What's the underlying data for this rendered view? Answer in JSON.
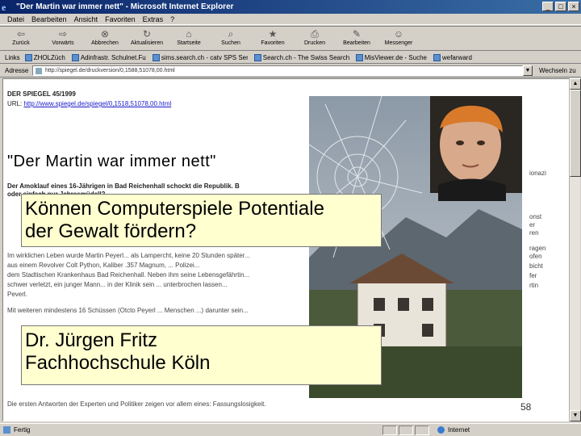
{
  "window": {
    "title": "\"Der Martin war immer nett\" - Microsoft Internet Explorer",
    "buttons": {
      "minimize": "_",
      "maximize": "□",
      "close": "×"
    }
  },
  "menu": [
    "Datei",
    "Bearbeiten",
    "Ansicht",
    "Favoriten",
    "Extras",
    "?"
  ],
  "toolbar": [
    {
      "label": "Zurück",
      "icon": "back-arrow-icon",
      "glyph": "⇦"
    },
    {
      "label": "Vorwärts",
      "icon": "forward-arrow-icon",
      "glyph": "⇨"
    },
    {
      "label": "Abbrechen",
      "icon": "stop-icon",
      "glyph": "⊗"
    },
    {
      "label": "Aktualisieren",
      "icon": "refresh-icon",
      "glyph": "↻"
    },
    {
      "label": "Startseite",
      "icon": "home-icon",
      "glyph": "⌂"
    },
    {
      "label": "Suchen",
      "icon": "search-icon",
      "glyph": "⌕"
    },
    {
      "label": "Favoriten",
      "icon": "favorites-icon",
      "glyph": "★"
    },
    {
      "label": "Drucken",
      "icon": "print-icon",
      "glyph": "⎙"
    },
    {
      "label": "Bearbeiten",
      "icon": "edit-icon",
      "glyph": "✎"
    },
    {
      "label": "Messenger",
      "icon": "messenger-icon",
      "glyph": "☺"
    }
  ],
  "links": {
    "label": "Links",
    "items": [
      "ZHOLZüch",
      "Adinfrastr. Schulnet.Fu",
      "sims.search.ch - catv SPS Service",
      "Search.ch - The Swiss Search Engine",
      "MisViewer.de - Suche",
      "wefarward"
    ]
  },
  "address": {
    "label": "Adresse",
    "value": "http://spiegel.de/druckversion/0,1588,51078,00.html",
    "go": "Wechseln zu"
  },
  "document": {
    "magazine": "DER SPIEGEL 45/1999",
    "url_label": "URL:",
    "url": "http://www.spiegel.de/spiegel/0,1518,51078,00.html",
    "headline": "\"Der Martin war immer nett\"",
    "lead_line1": "Der Amoklauf eines 16-Jährigen in Bad Reichenhall schockt die Republik. B",
    "lead_line2": "oder einfach nur Jahresmüdell?",
    "right_fragments": [
      "ionazi",
      "onst",
      "er",
      "ren",
      "ragen",
      "ofen",
      "bicht",
      "fer",
      "rtin"
    ],
    "body_line1": "Im wirklichen Leben wurde Martin Peyerl... als Lampercht, keine 20 Stunden später...",
    "body_line2": "aus einem Revolver Colt Python, Kaliber .357 Magnum, ... Polizei...",
    "body_line3": "dem Stadtischen Krankenhaus Bad Reichenhall. Neben ihm seine Lebensgefährtin...",
    "body_line4": "schwer verletzt, ein junger Mann... in der Klinik sein ... unterbrochen lassen...",
    "body_line5": "Peverl.",
    "body_line6": "Mit weiteren mindestens 16 Schüssen (Otcto Peyerl ... Menschen ...) darunter sein...",
    "body_line7": "Die ersten Antworten der Experten und Politiker zeigen vor allem eines: Fassungslosigkeit."
  },
  "overlays": {
    "box1": [
      "Können Computerspiele Potentiale",
      "der Gewalt fördern?"
    ],
    "box2": [
      "Dr. Jürgen Fritz",
      "Fachhochschule Köln"
    ]
  },
  "page_number": "58",
  "status": {
    "left": "Fertig",
    "right": "Internet"
  }
}
